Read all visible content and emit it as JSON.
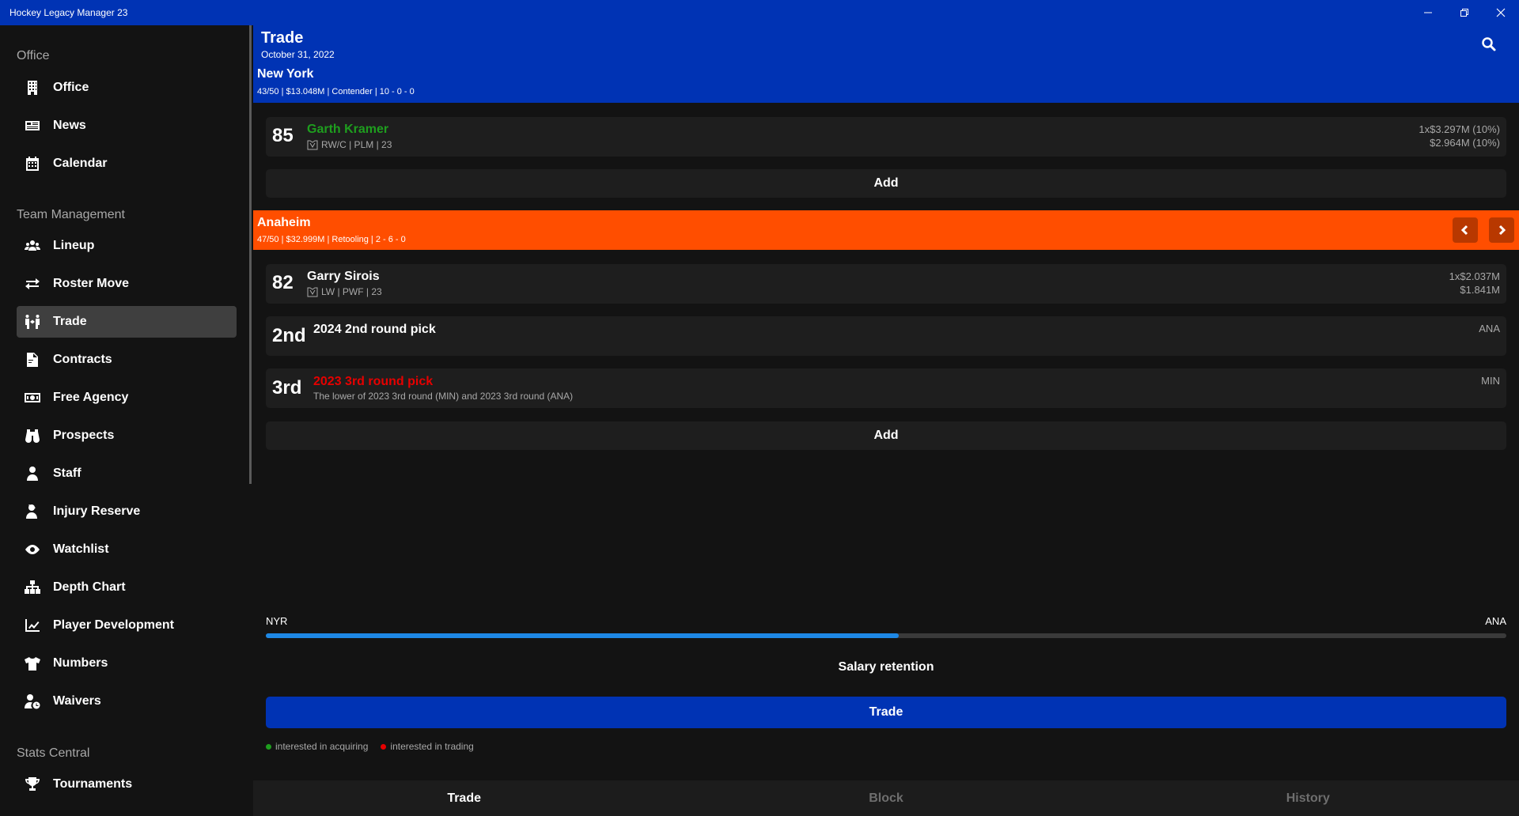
{
  "window": {
    "title": "Hockey Legacy Manager 23"
  },
  "sidebar": {
    "groups": [
      {
        "title": "Office",
        "items": [
          "Office",
          "News",
          "Calendar"
        ]
      },
      {
        "title": "Team Management",
        "items": [
          "Lineup",
          "Roster Move",
          "Trade",
          "Contracts",
          "Free Agency",
          "Prospects",
          "Staff",
          "Injury Reserve",
          "Watchlist",
          "Depth Chart",
          "Player Development",
          "Numbers",
          "Waivers"
        ]
      },
      {
        "title": "Stats Central",
        "items": [
          "Tournaments"
        ]
      }
    ],
    "active": "Trade"
  },
  "header": {
    "title": "Trade",
    "date": "October 31, 2022",
    "team": "New York",
    "info": "43/50 | $13.048M | Contender | 10 - 0 - 0"
  },
  "my_assets": [
    {
      "rating": "85",
      "name": "Garth Kramer",
      "name_color": "#1e9e1e",
      "meta": "RW/C | PLM | 23",
      "contract": "1x$3.297M (10%)",
      "cap": "$2.964M (10%)"
    }
  ],
  "add_label": "Add",
  "other_team": {
    "name": "Anaheim",
    "info": "47/50 | $32.999M | Retooling | 2 - 6 - 0"
  },
  "their_assets": {
    "player": {
      "rating": "82",
      "name": "Garry Sirois",
      "meta": "LW | PWF | 23",
      "contract": "1x$2.037M",
      "cap": "$1.841M"
    },
    "picks": [
      {
        "round": "2nd",
        "name": "2024 2nd round pick",
        "name_color": "#ffffff",
        "sub": "",
        "team": "ANA"
      },
      {
        "round": "3rd",
        "name": "2023 3rd round pick",
        "name_color": "#e60000",
        "sub": "The lower of 2023 3rd round (MIN) and 2023 3rd round (ANA)",
        "team": "MIN"
      }
    ]
  },
  "balance": {
    "left": "NYR",
    "right": "ANA",
    "value": 0.51
  },
  "salary_retention": "Salary retention",
  "trade_button": "Trade",
  "legend": [
    {
      "label": "interested in acquiring",
      "color": "#1e9e1e"
    },
    {
      "label": "interested in trading",
      "color": "#e60000"
    }
  ],
  "tabs": [
    "Trade",
    "Block",
    "History"
  ],
  "active_tab": "Trade"
}
